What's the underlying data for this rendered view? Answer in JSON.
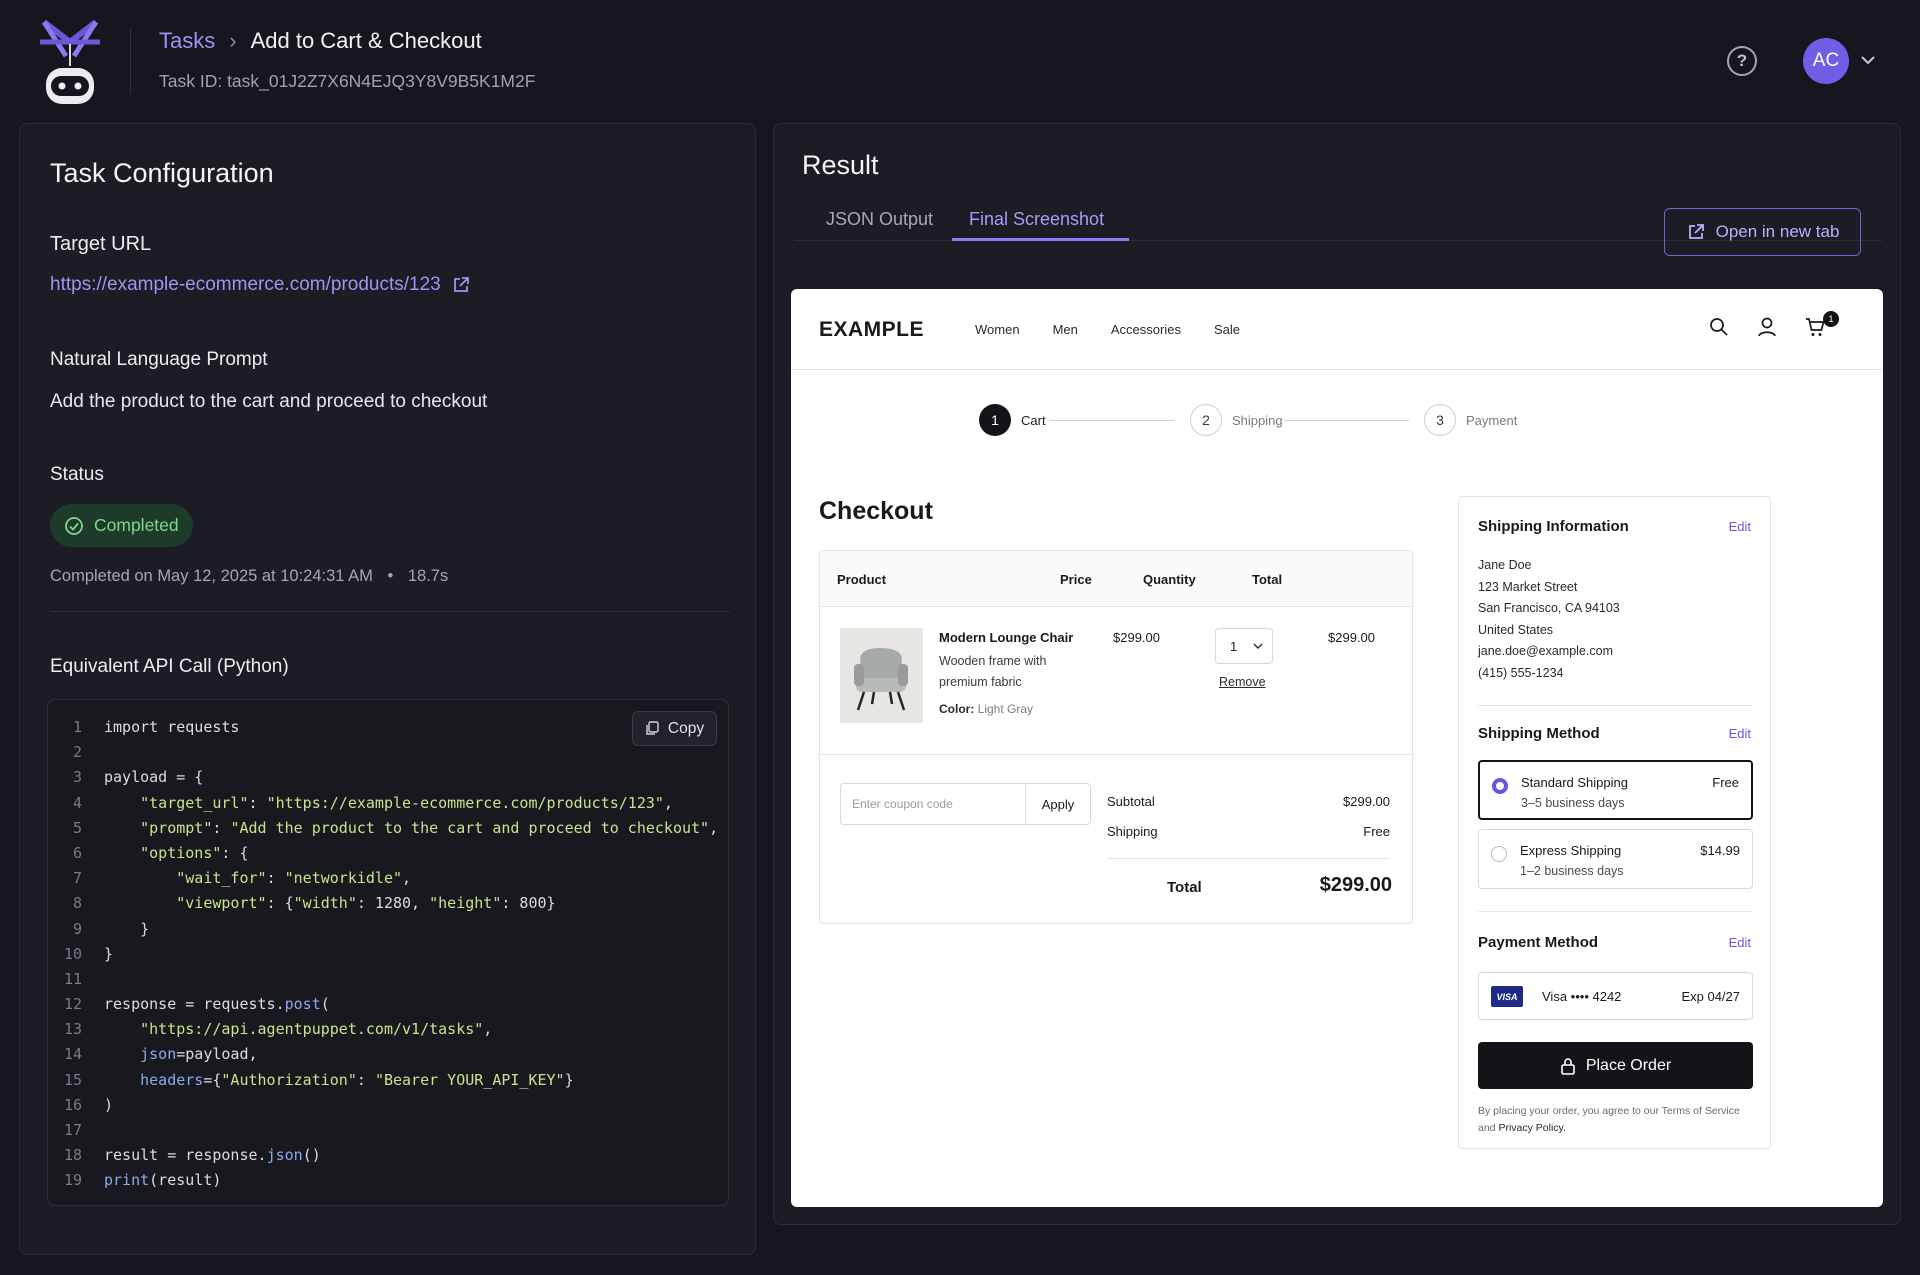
{
  "header": {
    "breadcrumb_root": "Tasks",
    "breadcrumb_sep": "›",
    "breadcrumb_current": "Add to Cart & Checkout",
    "task_id": "Task ID: task_01J2Z7X6N4EJQ3Y8V9B5K1M2F",
    "avatar_initials": "AC",
    "icons": [
      "robot-logo",
      "help-icon",
      "chevron-down-icon"
    ]
  },
  "config": {
    "title": "Task Configuration",
    "target_url_label": "Target URL",
    "target_url": "https://example-ecommerce.com/products/123",
    "prompt_label": "Natural Language Prompt",
    "prompt": "Add the product to the cart and proceed to checkout",
    "status_label": "Status",
    "status": "Completed",
    "completed_on": "Completed on May 12, 2025 at 10:24:31 AM",
    "duration": "18.7s",
    "api_label": "Equivalent API Call (Python)",
    "copy_label": "Copy",
    "status_color": "#7fd88a",
    "accent": "#9b95f3"
  },
  "code": {
    "lines": [
      "import requests",
      "",
      "payload = {",
      "    \"target_url\": \"https://example-ecommerce.com/products/123\",",
      "    \"prompt\": \"Add the product to the cart and proceed to checkout\",",
      "    \"options\": {",
      "        \"wait_for\": \"networkidle\",",
      "        \"viewport\": {\"width\": 1280, \"height\": 800}",
      "    }",
      "}",
      "",
      "response = requests.post(",
      "    \"https://api.agentpuppet.com/v1/tasks\",",
      "    json=payload,",
      "    headers={\"Authorization\": \"Bearer YOUR_API_KEY\"}",
      ")",
      "",
      "result = response.json()",
      "print(result)"
    ]
  },
  "result": {
    "title": "Result",
    "tabs": [
      "JSON Output",
      "Final Screenshot"
    ],
    "active_tab": "Final Screenshot",
    "open_new_tab": "Open in new tab"
  },
  "shot": {
    "brand": "EXAMPLE",
    "nav": [
      "Women",
      "Men",
      "Accessories",
      "Sale"
    ],
    "cart_count": "1",
    "steps": [
      {
        "num": "1",
        "label": "Cart"
      },
      {
        "num": "2",
        "label": "Shipping"
      },
      {
        "num": "3",
        "label": "Payment"
      }
    ],
    "checkout_title": "Checkout",
    "cols": {
      "product": "Product",
      "price": "Price",
      "quantity": "Quantity",
      "total": "Total"
    },
    "item": {
      "name": "Modern Lounge Chair",
      "desc": "Wooden frame with premium fabric",
      "color_label": "Color:",
      "color_value": "Light Gray",
      "price": "$299.00",
      "qty": "1",
      "remove": "Remove",
      "total": "$299.00"
    },
    "coupon_placeholder": "Enter coupon code",
    "apply": "Apply",
    "subtotal_label": "Subtotal",
    "subtotal": "$299.00",
    "shipping_label": "Shipping",
    "shipping": "Free",
    "total_label": "Total",
    "total": "$299.00",
    "ship_info_title": "Shipping Information",
    "edit": "Edit",
    "address": [
      "Jane Doe",
      "123 Market Street",
      "San Francisco, CA 94103",
      "United States",
      "jane.doe@example.com",
      "(415) 555-1234"
    ],
    "ship_method_title": "Shipping Method",
    "standard_name": "Standard Shipping",
    "standard_sub": "3–5 business days",
    "standard_price": "Free",
    "express_name": "Express Shipping",
    "express_sub": "1–2 business days",
    "express_price": "$14.99",
    "payment_title": "Payment Method",
    "card_brand": "VISA",
    "card": "Visa •••• 4242",
    "card_exp": "Exp 04/27",
    "place_order": "Place Order",
    "terms_prefix": "By placing your order, you agree to our Terms of Service and ",
    "terms_link": "Privacy Policy."
  }
}
